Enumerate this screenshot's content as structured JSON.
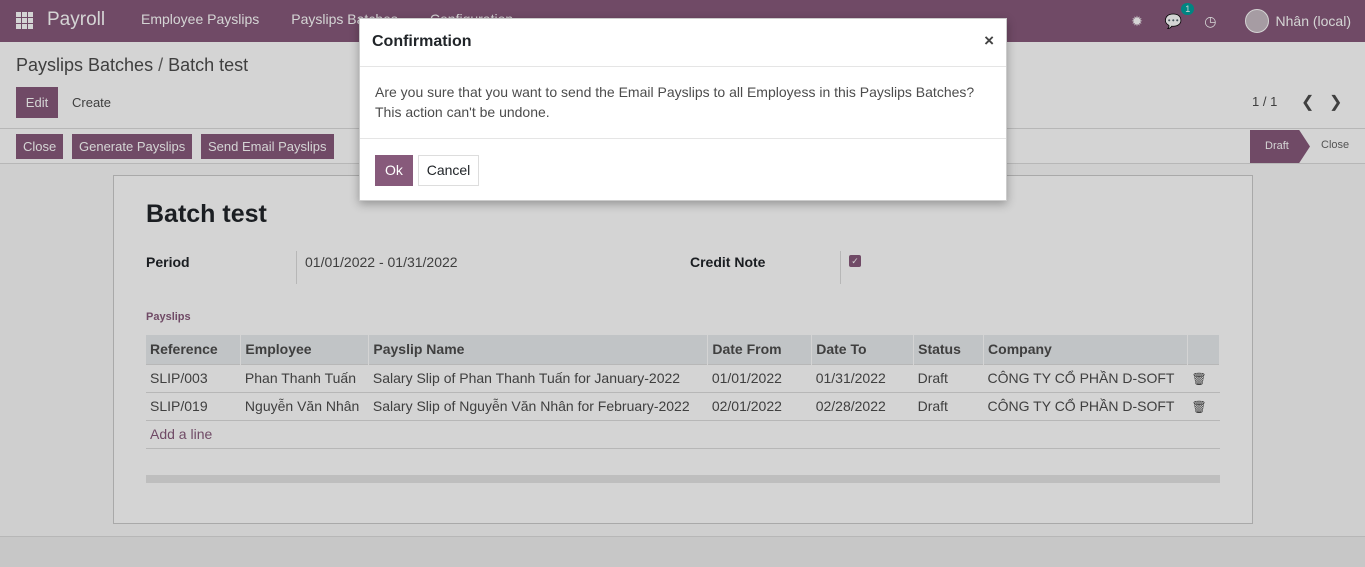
{
  "navbar": {
    "brand": "Payroll",
    "menu": [
      "Employee Payslips",
      "Payslips Batches",
      "Configuration"
    ],
    "icons": [
      "bug-icon",
      "chat-icon",
      "clock-icon"
    ],
    "chat_badge": "1",
    "user": "Nhân (local)"
  },
  "breadcrumb": {
    "parent": "Payslips Batches",
    "sep": "/",
    "current": "Batch test"
  },
  "control": {
    "edit": "Edit",
    "create": "Create",
    "pager": "1 / 1",
    "prev": "‹",
    "next": "›"
  },
  "statusbar": {
    "buttons": [
      "Close",
      "Generate Payslips",
      "Send Email Payslips"
    ],
    "stages": [
      "Draft",
      "Close"
    ]
  },
  "form": {
    "title": "Batch test",
    "period_label": "Period",
    "period_value": "01/01/2022 - 01/31/2022",
    "credit_note_label": "Credit Note",
    "credit_note_checked": "✓",
    "section": "Payslips",
    "columns": [
      "Reference",
      "Employee",
      "Payslip Name",
      "Date From",
      "Date To",
      "Status",
      "Company"
    ],
    "rows": [
      [
        "SLIP/003",
        "Phan Thanh Tuấn",
        "Salary Slip of Phan Thanh Tuấn for January-2022",
        "01/01/2022",
        "01/31/2022",
        "Draft",
        "CÔNG TY CỔ PHẦN D-SOFT"
      ],
      [
        "SLIP/019",
        "Nguyễn Văn Nhân",
        "Salary Slip of Nguyễn Văn Nhân for February-2022",
        "02/01/2022",
        "02/28/2022",
        "Draft",
        "CÔNG TY CỔ PHẦN D-SOFT"
      ]
    ],
    "add_line": "Add a line"
  },
  "modal": {
    "title": "Confirmation",
    "close": "×",
    "body": "Are you sure that you want to send the Email Payslips to all Employess in this Payslips Batches? This action can't be undone.",
    "ok": "Ok",
    "cancel": "Cancel"
  },
  "colors": {
    "primary": "#875a7b"
  }
}
